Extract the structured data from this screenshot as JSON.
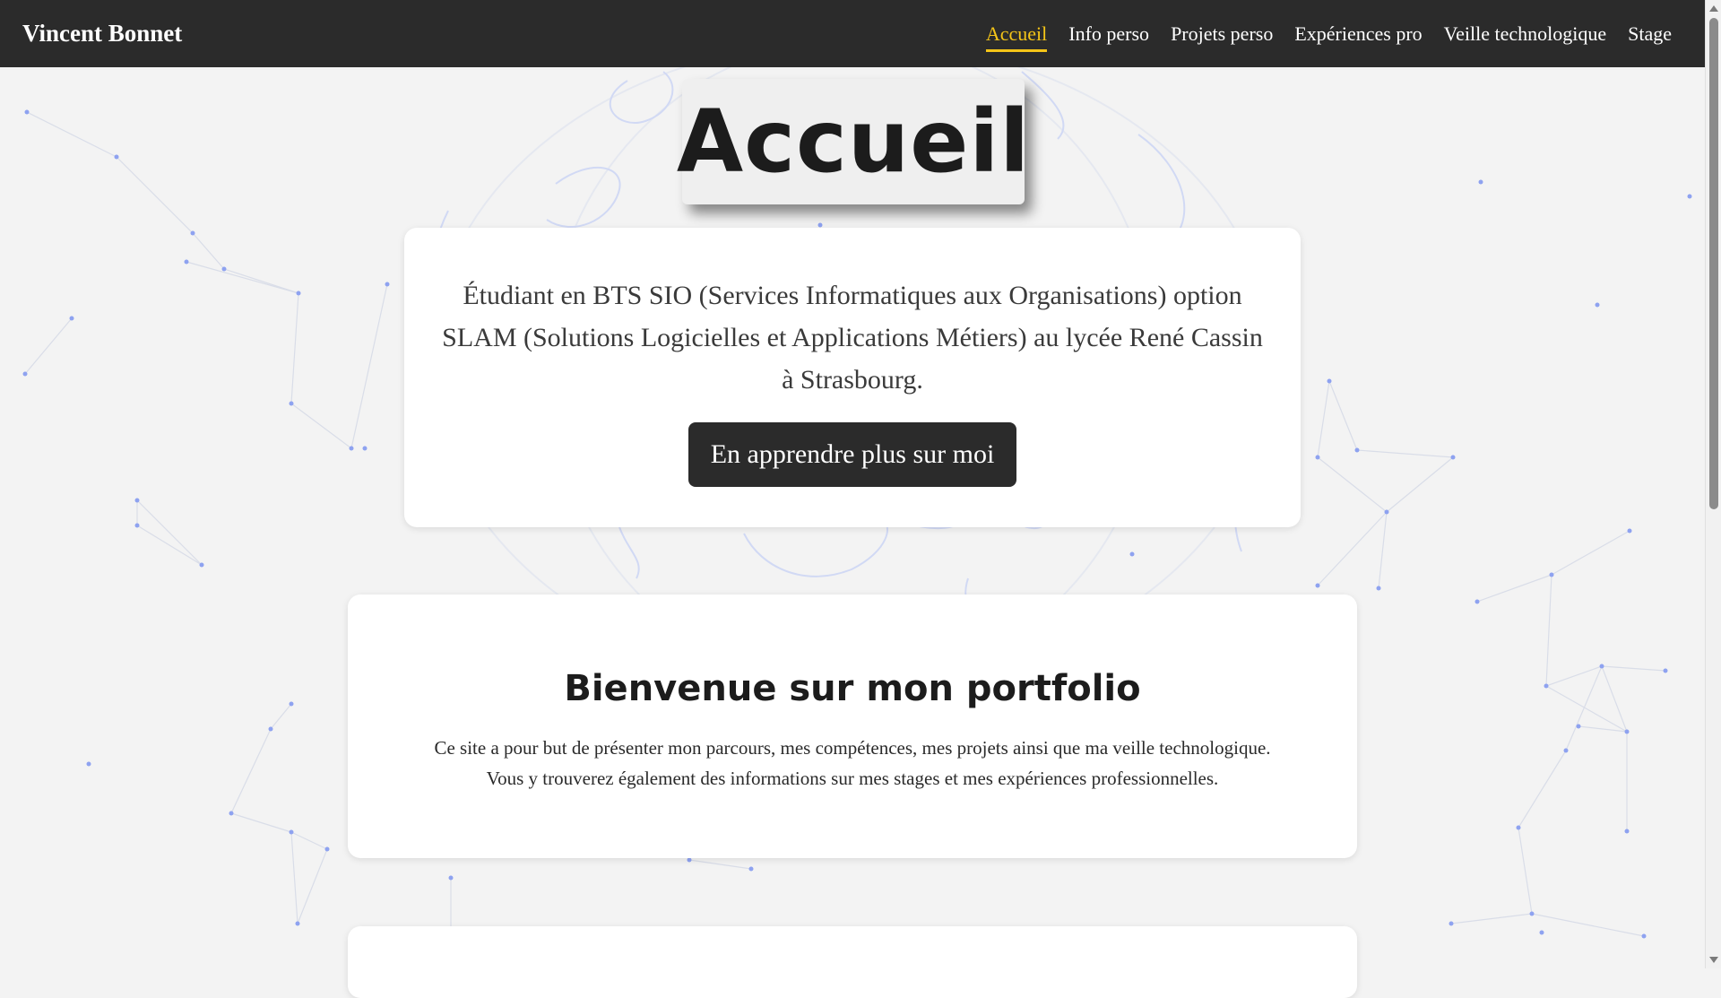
{
  "navbar": {
    "brand": "Vincent Bonnet",
    "links": [
      {
        "label": "Accueil",
        "active": true
      },
      {
        "label": "Info perso",
        "active": false
      },
      {
        "label": "Projets perso",
        "active": false
      },
      {
        "label": "Expériences pro",
        "active": false
      },
      {
        "label": "Veille technologique",
        "active": false
      },
      {
        "label": "Stage",
        "active": false
      }
    ],
    "active_color": "#f5c518",
    "background_color": "#2b2b2b"
  },
  "hero": {
    "title": "Accueil"
  },
  "intro": {
    "text": "Étudiant en BTS SIO (Services Informatiques aux Organisations) option SLAM (Solutions Logicielles et Applications Métiers) au lycée René Cassin à Strasbourg.",
    "button_label": "En apprendre plus sur moi"
  },
  "welcome": {
    "title": "Bienvenue sur mon portfolio",
    "text_line1": "Ce site a pour but de présenter mon parcours, mes compétences, mes projets ainsi que ma veille technologique.",
    "text_line2": "Vous y trouverez également des informations sur mes stages et mes expériences professionnelles."
  },
  "colors": {
    "page_background": "#f3f3f3",
    "network_node": "#8ea2f0",
    "card_background": "#ffffff",
    "button_background": "#2b2b2b"
  }
}
